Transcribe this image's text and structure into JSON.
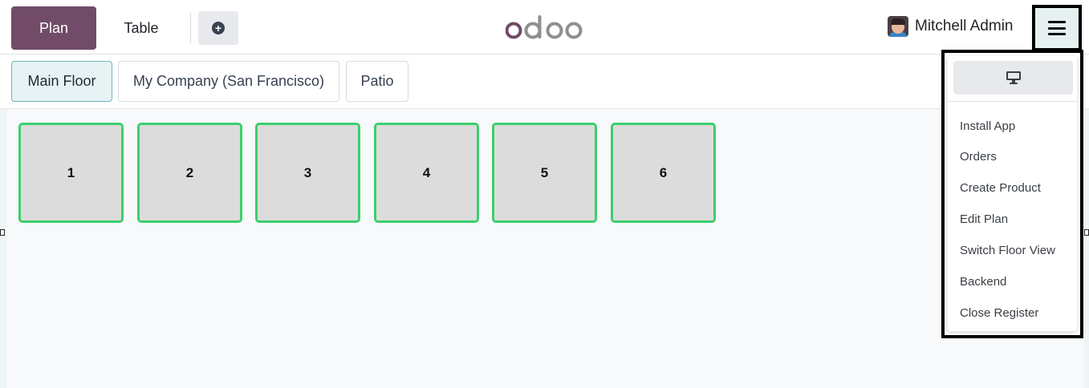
{
  "navbar": {
    "plan_label": "Plan",
    "table_label": "Table",
    "add_icon": "plus-circle-icon",
    "logo_text": "odoo",
    "user_name": "Mitchell Admin",
    "menu_icon": "hamburger-icon"
  },
  "floors": [
    "Main Floor",
    "My Company (San Francisco)",
    "Patio"
  ],
  "active_floor": "Main Floor",
  "tables": [
    "1",
    "2",
    "3",
    "4",
    "5",
    "6"
  ],
  "menu": {
    "display_icon": "monitor-icon",
    "items": [
      "Install App",
      "Orders",
      "Create Product",
      "Edit Plan",
      "Switch Floor View",
      "Backend",
      "Close Register"
    ]
  },
  "colors": {
    "brand": "#714b67",
    "table_border": "#3ccf6e",
    "table_fill": "#dcdcdc",
    "active_tab_bg": "#e6f2f3",
    "logo_gray": "#8f8f8f"
  }
}
